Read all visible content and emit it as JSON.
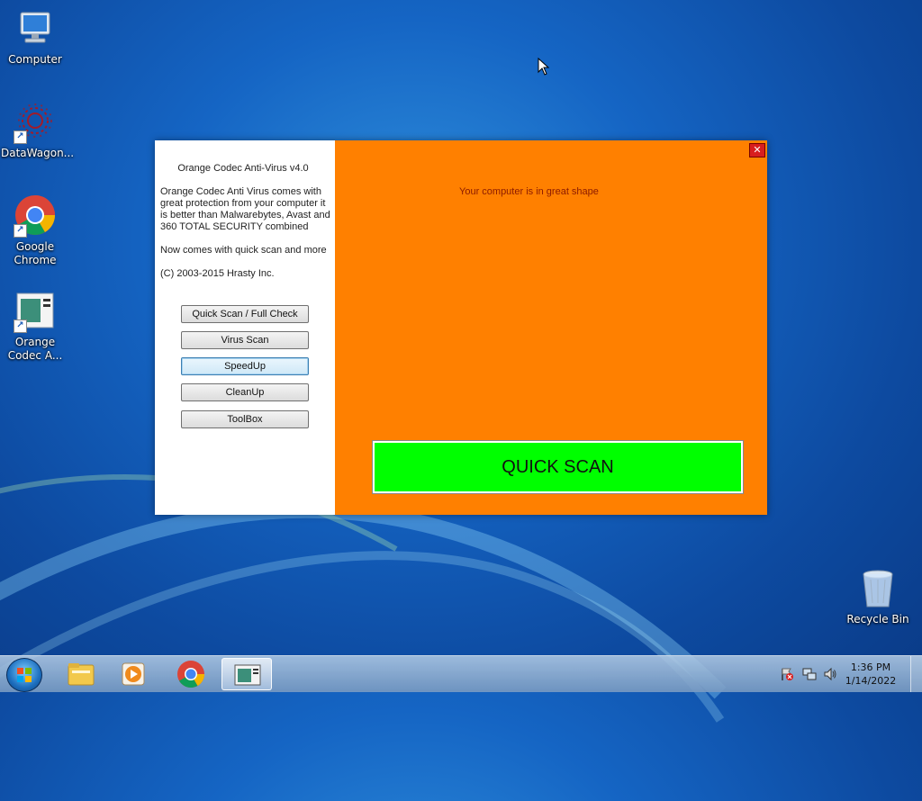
{
  "desktop": {
    "icons": [
      {
        "label": "Computer",
        "icon": "computer-icon"
      },
      {
        "label": "DataWagon...",
        "icon": "datawagon-icon"
      },
      {
        "label": "Google Chrome",
        "icon": "chrome-icon"
      },
      {
        "label": "Orange Codec A...",
        "icon": "orange-codec-icon"
      }
    ],
    "recycle_bin": {
      "label": "Recycle Bin",
      "icon": "recycle-bin-icon"
    }
  },
  "app": {
    "title": "Orange Codec Anti-Virus v4.0",
    "description": [
      "Orange Codec Anti Virus comes with great protection from your computer it is better than Malwarebytes, Avast and 360 TOTAL SECURITY combined",
      "Now comes with quick scan and more",
      "(C) 2003-2015 Hrasty Inc."
    ],
    "buttons": [
      "Quick Scan / Full Check",
      "Virus Scan",
      "SpeedUp",
      "CleanUp",
      "ToolBox"
    ],
    "status": "Your computer is in great shape",
    "quick_scan_label": "QUICK SCAN",
    "close_glyph": "✕",
    "colors": {
      "panel": "#ff8000",
      "quick_scan": "#00ff00",
      "close": "#d81e1e"
    }
  },
  "taskbar": {
    "pinned": [
      {
        "icon": "start-orb-icon"
      },
      {
        "icon": "file-explorer-icon"
      },
      {
        "icon": "media-player-icon"
      },
      {
        "icon": "chrome-icon"
      },
      {
        "icon": "orange-codec-icon",
        "active": true
      }
    ],
    "tray_icons": [
      "action-center-flag-icon",
      "network-icon",
      "volume-icon"
    ],
    "time": "1:36 PM",
    "date": "1/14/2022"
  }
}
